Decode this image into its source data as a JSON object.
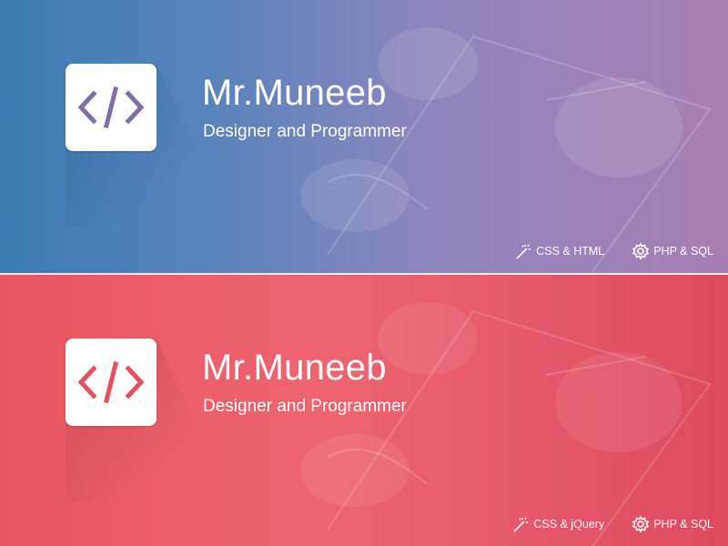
{
  "banners": [
    {
      "theme": "blue",
      "accent": "#7f6fa6",
      "icon": "code-brackets-icon",
      "title": "Mr.Muneeb",
      "subtitle": "Designer and Programmer",
      "skills": [
        {
          "icon": "magic-wand-icon",
          "label": "CSS & HTML"
        },
        {
          "icon": "gear-icon",
          "label": "PHP & SQL"
        }
      ]
    },
    {
      "theme": "red",
      "accent": "#e5505c",
      "icon": "code-brackets-icon",
      "title": "Mr.Muneeb",
      "subtitle": "Designer and Programmer",
      "skills": [
        {
          "icon": "magic-wand-icon",
          "label": "CSS & jQuery"
        },
        {
          "icon": "gear-icon",
          "label": "PHP & SQL"
        }
      ]
    }
  ]
}
